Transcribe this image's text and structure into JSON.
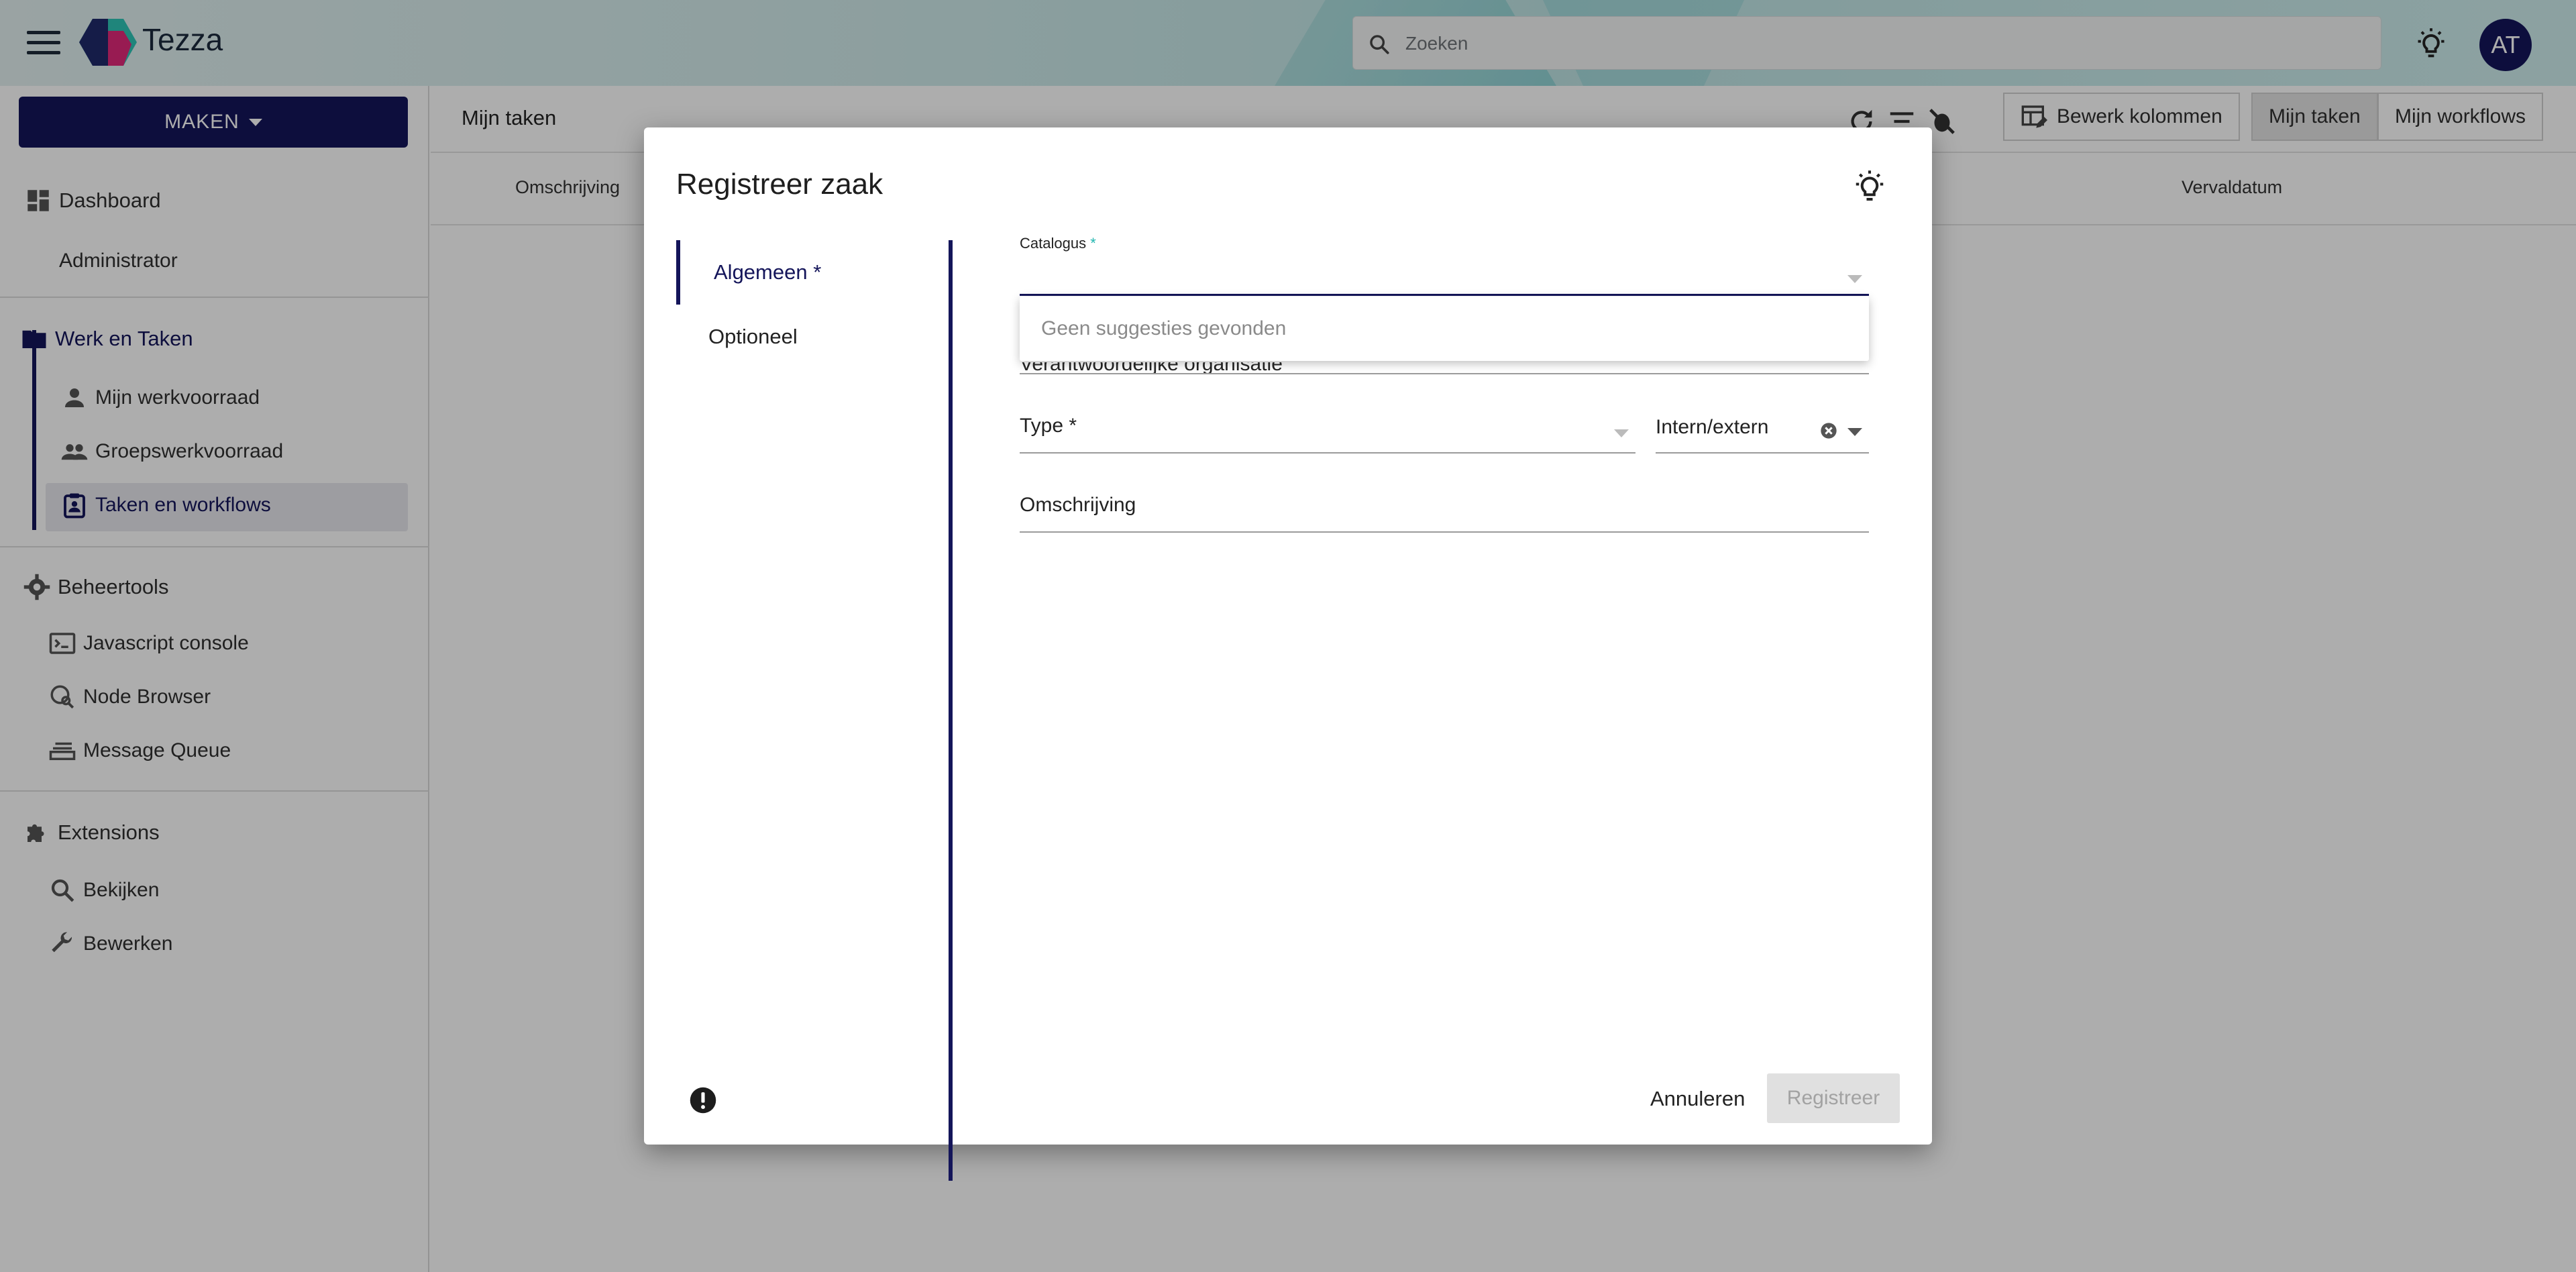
{
  "app": {
    "title": "Tezza",
    "avatar_initials": "AT"
  },
  "search": {
    "placeholder": "Zoeken"
  },
  "sidebar": {
    "create_label": "MAKEN",
    "dashboard": "Dashboard",
    "administrator": "Administrator",
    "work_tasks": "Werk en Taken",
    "my_workqueue": "Mijn werkvoorraad",
    "group_workqueue": "Groepswerkvoorraad",
    "tasks_workflows": "Taken en workflows",
    "admin_tools": "Beheertools",
    "js_console": "Javascript console",
    "node_browser": "Node Browser",
    "message_queue": "Message Queue",
    "extensions": "Extensions",
    "view": "Bekijken",
    "edit": "Bewerken"
  },
  "content": {
    "title": "Mijn taken",
    "edit_columns": "Bewerk kolommen",
    "my_tasks_tab": "Mijn taken",
    "my_workflows_tab": "Mijn workflows",
    "col_description": "Omschrijving",
    "col_due_date": "Vervaldatum"
  },
  "dialog": {
    "title": "Registreer zaak",
    "steps": [
      "Algemeen *",
      "Optioneel"
    ],
    "catalog_label": "Catalogus",
    "required_mark": "*",
    "no_suggestions": "Geen suggesties gevonden",
    "responsible_org": "Verantwoordelijke organisatie",
    "type_label": "Type *",
    "intern_extern_label": "Intern/extern",
    "description_label": "Omschrijving",
    "cancel_label": "Annuleren",
    "register_label": "Registreer"
  },
  "colors": {
    "primary": "#14155a",
    "accent": "#23b6b0"
  }
}
